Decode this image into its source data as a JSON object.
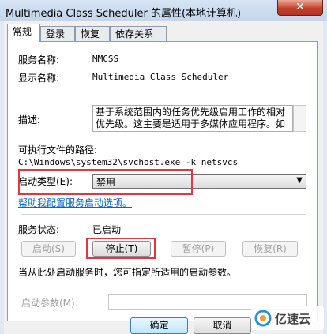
{
  "window": {
    "title": "Multimedia Class Scheduler 的属性(本地计算机)",
    "close_glyph": "✕"
  },
  "tabs": [
    "常规",
    "登录",
    "恢复",
    "依存关系"
  ],
  "general": {
    "service_name_label": "服务名称:",
    "service_name_value": "MMCSS",
    "display_name_label": "显示名称:",
    "display_name_value": "Multimedia Class Scheduler",
    "description_label": "描述:",
    "description_value": "基于系统范围内的任务优先级启用工作的相对优先级。这主要是适用于多媒体应用程序。如果",
    "exe_path_label": "可执行文件的路径:",
    "exe_path_value": "C:\\Windows\\system32\\svchost.exe -k netsvcs",
    "startup_type_label": "启动类型(E):",
    "startup_type_value": "禁用",
    "help_link": "帮助我配置服务启动选项。",
    "status_label": "服务状态:",
    "status_value": "已启动",
    "buttons": {
      "start": "启动(S)",
      "stop": "停止(T)",
      "pause": "暂停(P)",
      "resume": "恢复(R)"
    },
    "hint": "当从此处启动服务时，您可指定所适用的启动参数。",
    "start_params_label": "启动参数(M):",
    "start_params_value": ""
  },
  "footer": {
    "ok": "确定",
    "cancel": "取消"
  },
  "watermark": {
    "text": "亿速云"
  },
  "colors": {
    "highlight_box": "#e8343c",
    "link": "#0066cc"
  },
  "icons": {
    "dropdown": "chevron-down-icon",
    "close": "close-icon",
    "watermark_logo": "cloud-logo-icon"
  }
}
